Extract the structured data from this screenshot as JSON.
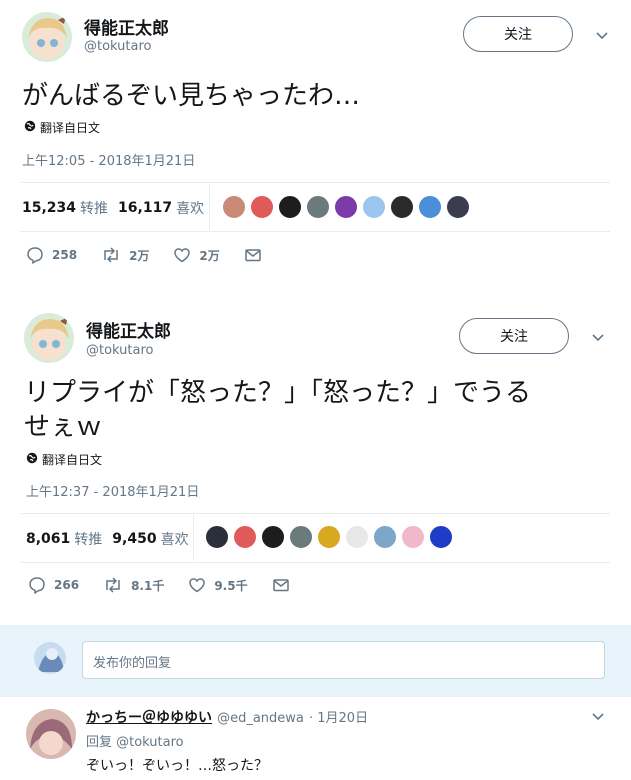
{
  "tweets": [
    {
      "display_name": "得能正太郎",
      "handle": "@tokutaro",
      "follow_label": "关注",
      "text": "がんばるぞい見ちゃったわ…",
      "translate_label": "翻译自日文",
      "timestamp": "上午12:05 - 2018年1月21日",
      "retweets_count": "15,234",
      "retweets_label": "转推",
      "likes_count": "16,117",
      "likes_label": "喜欢",
      "replies": "258",
      "retweets_short": "2万",
      "likes_short": "2万"
    },
    {
      "display_name": "得能正太郎",
      "handle": "@tokutaro",
      "follow_label": "关注",
      "text_line1": "リプライが「怒った？」「怒った？」でうる",
      "text_line2": "せぇｗ",
      "translate_label": "翻译自日文",
      "timestamp": "上午12:37 - 2018年1月21日",
      "retweets_count": "8,061",
      "retweets_label": "转推",
      "likes_count": "9,450",
      "likes_label": "喜欢",
      "replies": "266",
      "retweets_short": "8.1千",
      "likes_short": "9.5千"
    }
  ],
  "reply_box": {
    "placeholder": "发布你的回复"
  },
  "reply": {
    "display_name": "かっちー＠ゆゆゆい",
    "handle": "@ed_andewa",
    "date": "· 1月20日",
    "reply_to": "回复 @tokutaro",
    "text": "ぞいっ！ぞいっ！…怒った？"
  },
  "colors": {
    "text_secondary": "#657786",
    "divider": "#e6ecf0",
    "reply_area_bg": "#e8f4fb"
  }
}
